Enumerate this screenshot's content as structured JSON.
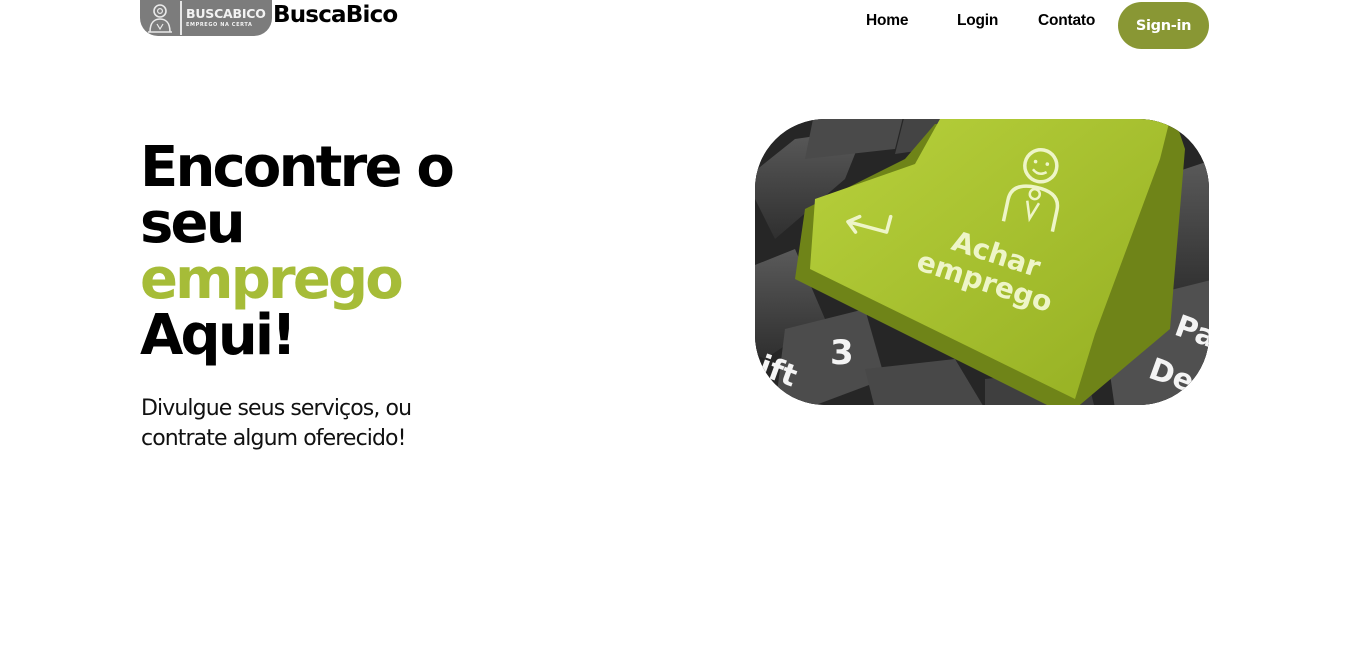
{
  "header": {
    "logo": {
      "wordmark": "BUSCABICO",
      "tagline": "EMPREGO NA CERTA"
    },
    "brand_name": "BuscaBico",
    "nav": {
      "home": "Home",
      "login": "Login",
      "contato": "Contato"
    },
    "signin_label": "Sign-in"
  },
  "hero": {
    "title_line1": "Encontre o",
    "title_line2": "seu",
    "title_line3_accent": "emprego",
    "title_line4": "Aqui!",
    "subtitle_line1": "Divulgue seus serviços, ou",
    "subtitle_line2": "contrate algum oferecido!",
    "image": {
      "key_label_line1": "Achar",
      "key_label_line2": "emprego",
      "side_key_1": "ift",
      "side_key_2": "3",
      "side_key_3": "Pa",
      "side_key_4": "De",
      "key_icon": "person-icon",
      "arrow_icon": "enter-arrow-icon"
    }
  },
  "colors": {
    "accent": "#a6bc38",
    "button": "#899734",
    "key_green": "#a4bf2a",
    "logo_bg": "#7c7c7c",
    "text": "#000000"
  }
}
